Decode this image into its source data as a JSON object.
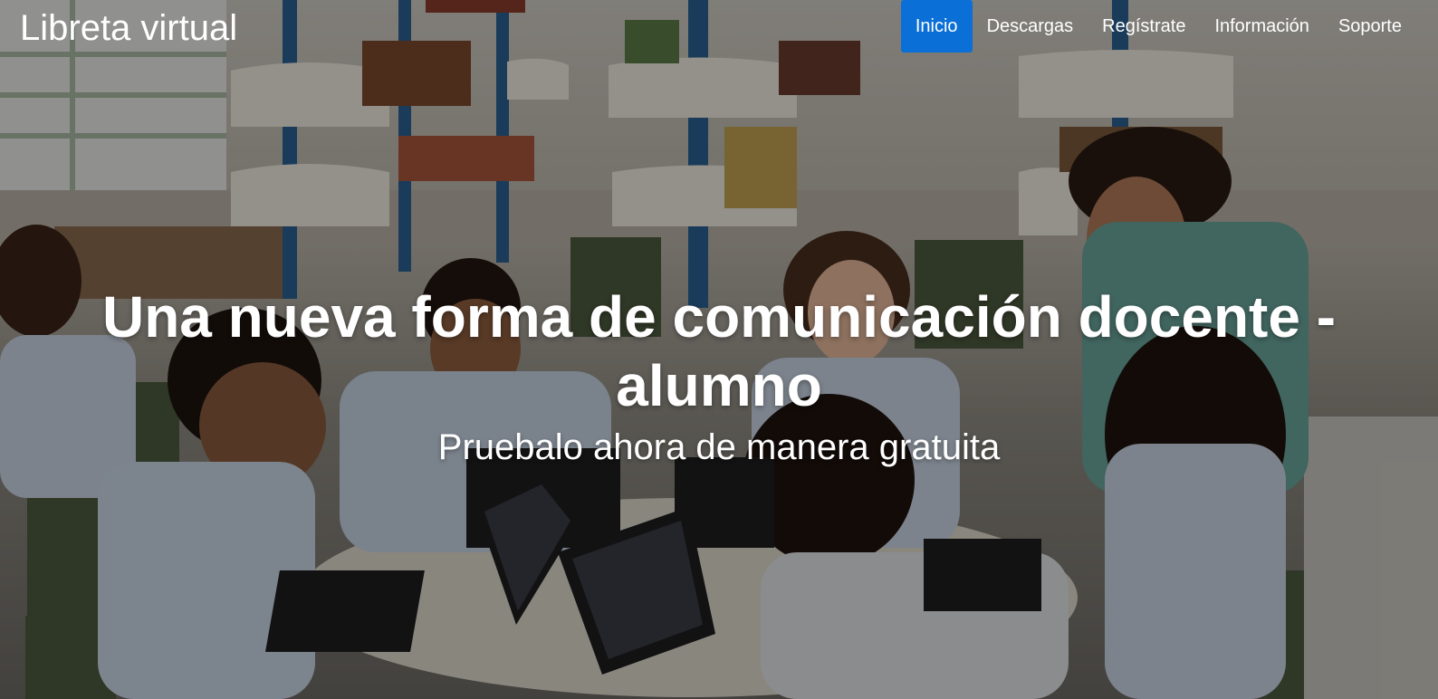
{
  "site": {
    "brand": "Libreta virtual"
  },
  "nav": {
    "items": [
      {
        "label": "Inicio",
        "active": true
      },
      {
        "label": "Descargas",
        "active": false
      },
      {
        "label": "Regístrate",
        "active": false
      },
      {
        "label": "Información",
        "active": false
      },
      {
        "label": "Soporte",
        "active": false
      }
    ]
  },
  "hero": {
    "title": "Una nueva forma de comunicación docente - alumno",
    "subtitle": "Pruebalo ahora de manera gratuita"
  },
  "colors": {
    "accent": "#0a6fd6",
    "text": "#ffffff"
  }
}
